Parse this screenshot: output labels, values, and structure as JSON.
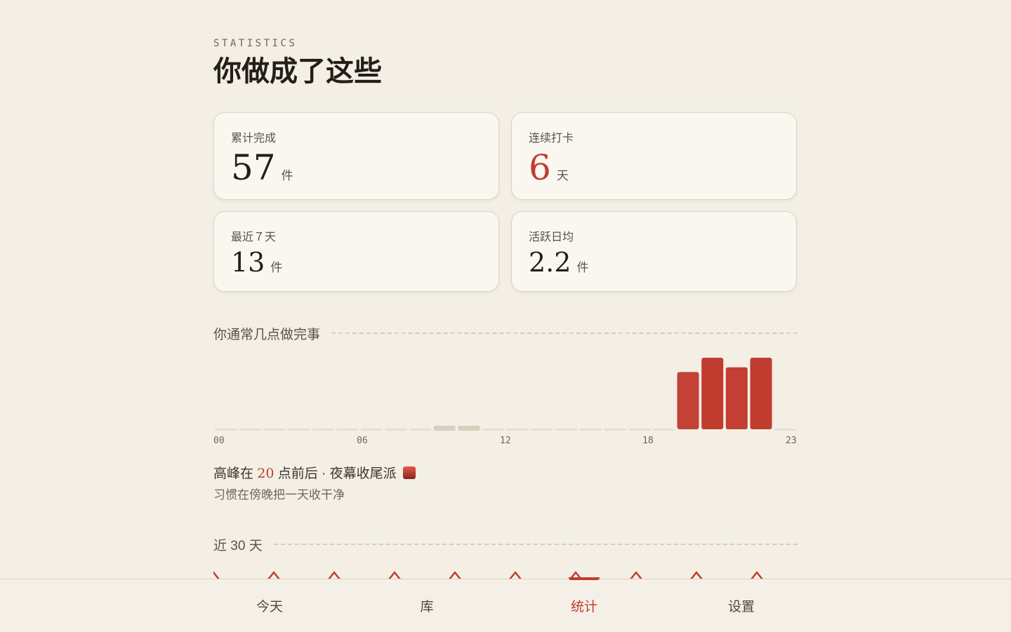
{
  "header": {
    "eyebrow": "STATISTICS",
    "title": "你做成了这些"
  },
  "stats": [
    {
      "label": "累计完成",
      "value": "57",
      "unit": "件"
    },
    {
      "label": "连续打卡",
      "value": "6",
      "unit": "天"
    },
    {
      "label": "最近７天",
      "value": "13",
      "unit": "件"
    },
    {
      "label": "活跃日均",
      "value": "2.2",
      "unit": "件"
    }
  ],
  "hour_section": {
    "title": "你通常几点做完事",
    "ticks": [
      "00",
      "06",
      "12",
      "18",
      "23"
    ],
    "peak": {
      "prefix": "高峰在",
      "hour": "20",
      "suffix": "点前后 · 夜幕收尾派",
      "icon": "city-dusk-icon",
      "subtitle": "习惯在傍晚把一天收干净"
    }
  },
  "month_section": {
    "title": "近 30 天"
  },
  "tabs": [
    {
      "label": "今天",
      "active": false
    },
    {
      "label": "库",
      "active": false
    },
    {
      "label": "统计",
      "active": true
    },
    {
      "label": "设置",
      "active": false
    }
  ],
  "colors": {
    "accent": "#c23b2f",
    "background": "#f3efe5",
    "card": "#faf7f0",
    "muted_bar": "#d9cfbf",
    "empty_bar": "#e6dfd2"
  },
  "chart_data": {
    "type": "bar",
    "categories": [
      "00",
      "01",
      "02",
      "03",
      "04",
      "05",
      "06",
      "07",
      "08",
      "09",
      "10",
      "11",
      "12",
      "13",
      "14",
      "15",
      "16",
      "17",
      "18",
      "19",
      "20",
      "21",
      "22",
      "23"
    ],
    "values": [
      0,
      0,
      0,
      0,
      0,
      0,
      0,
      0,
      0,
      1,
      1,
      0,
      0,
      0,
      0,
      0,
      0,
      0,
      0,
      12,
      15,
      13,
      15,
      0
    ],
    "title": "",
    "xlabel": "",
    "ylabel": "",
    "grid": false
  }
}
